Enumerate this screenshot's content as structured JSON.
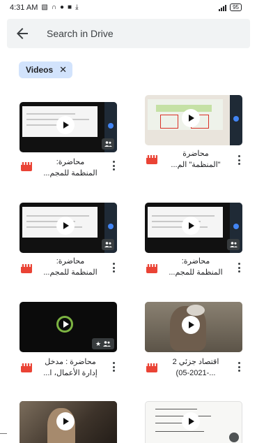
{
  "status_bar": {
    "time": "4:31 AM",
    "icons_left": [
      "gallery-icon",
      "headset-icon",
      "chrome-icon",
      "app-icon",
      "download-icon"
    ],
    "battery": "95"
  },
  "search": {
    "placeholder": "Search in Drive"
  },
  "filter_chip": {
    "label": "Videos",
    "close": "✕"
  },
  "files": [
    {
      "name": "محاضرة:\nالمنظمة للمجم...",
      "thumbnail": "slide-dark"
    },
    {
      "name": "محاضرة\n\"المنظمة\" الم...",
      "thumbnail": "slide-light"
    },
    {
      "name": "محاضرة:\nالمنظمة للمجم...",
      "thumbnail": "slide-dark"
    },
    {
      "name": "محاضرة:\nالمنظمة للمجم...",
      "thumbnail": "slide-dark"
    },
    {
      "name": "محاضرة : مدخل\nإدارة الأعمال، ا...",
      "thumbnail": "black-starred"
    },
    {
      "name": "اقتصاد جزئي 2\n...-05-2021)",
      "thumbnail": "camera"
    },
    {
      "name": "",
      "thumbnail": "camera"
    },
    {
      "name": "",
      "thumbnail": "handwritten"
    }
  ],
  "colors": {
    "accent_chip": "#d2e3fc",
    "video_icon": "#ea4335",
    "search_bg": "#f1f3f4"
  }
}
